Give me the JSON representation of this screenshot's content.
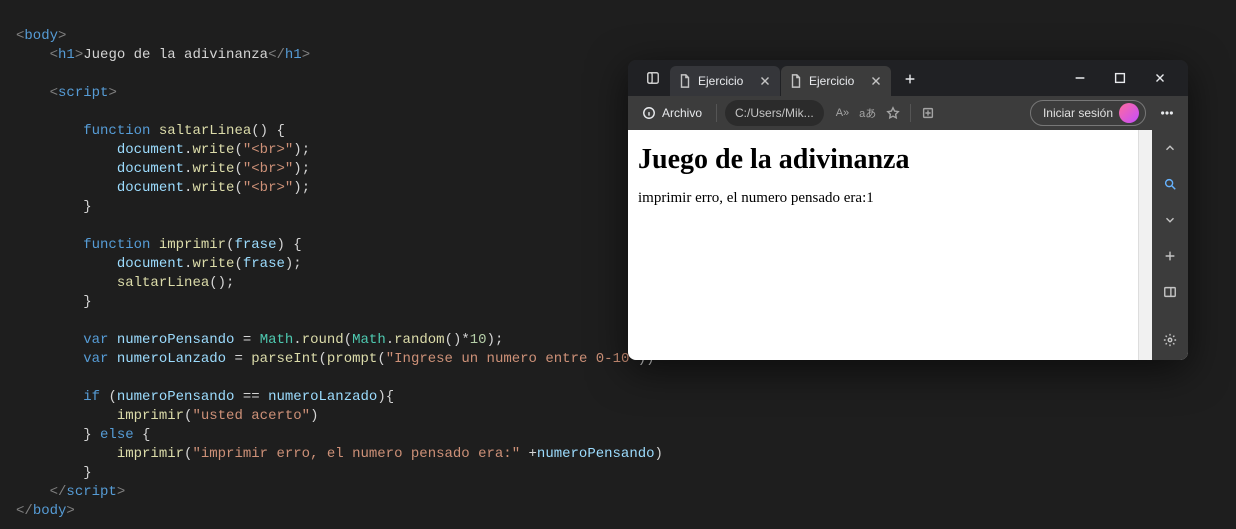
{
  "code": {
    "body_open": "<body>",
    "h1_open": "<h1>",
    "h1_text": "Juego de la adivinanza",
    "h1_close": "</h1>",
    "script_open": "<script>",
    "fn_keyword": "function",
    "fn1_name": "saltarLinea",
    "doc_write": "document",
    "write_fn": "write",
    "br_str": "\"<br>\"",
    "fn2_name": "imprimir",
    "fn2_param": "frase",
    "var_kw": "var",
    "numPensando": "numeroPensando",
    "numLanzado": "numeroLanzado",
    "math": "Math",
    "round": "round",
    "random": "random",
    "ten": "10",
    "parseInt": "parseInt",
    "prompt": "prompt",
    "prompt_str": "\"Ingrese un numero entre 0-10\"",
    "if_kw": "if",
    "else_kw": "else",
    "eq": "==",
    "acerto_str": "\"usted acerto\"",
    "err_str": "\"imprimir erro, el numero pensado era:\"",
    "script_close": "</​script>",
    "body_close": "</body>"
  },
  "browser": {
    "tab1": "Ejercicio",
    "tab2": "Ejercicio",
    "addr_label": "Archivo",
    "addr_path": "C:/Users/Mik...",
    "read_aloud": "A»",
    "translate": "aあ",
    "signin": "Iniciar sesión"
  },
  "page": {
    "heading": "Juego de la adivinanza",
    "body_text": "imprimir erro, el numero pensado era:1"
  }
}
